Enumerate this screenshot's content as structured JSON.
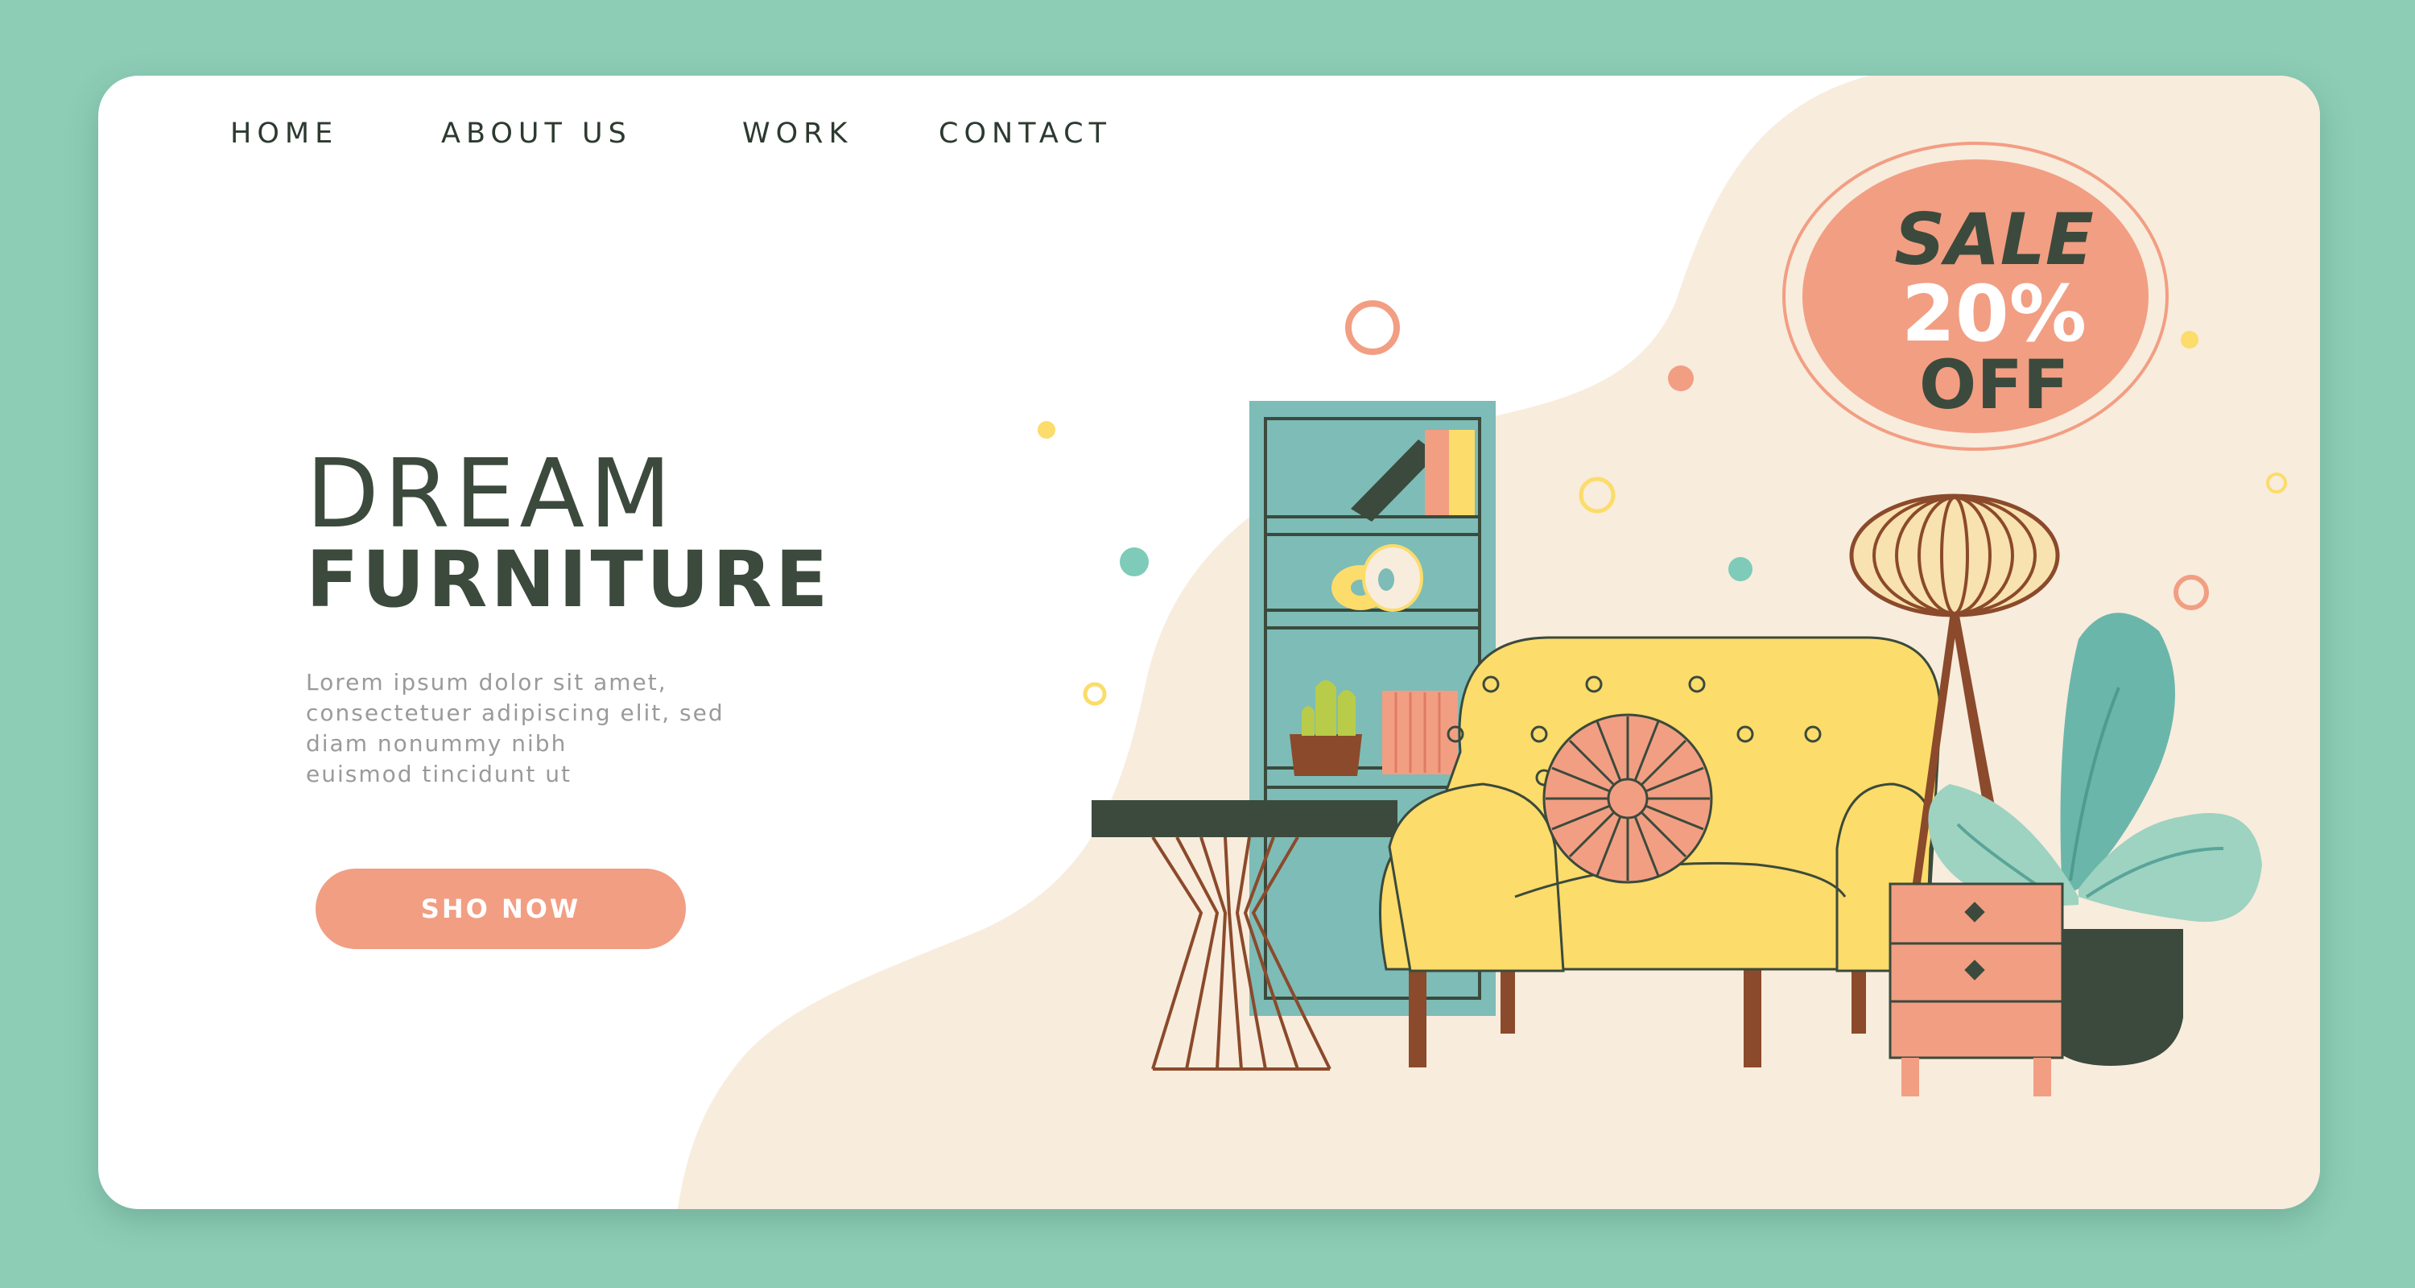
{
  "nav": {
    "items": [
      {
        "label": "HOME"
      },
      {
        "label": "ABOUT US"
      },
      {
        "label": "WORK"
      },
      {
        "label": "CONTACT"
      }
    ]
  },
  "hero": {
    "title_line1": "DREAM",
    "title_line2": "FURNITURE",
    "body_lines": [
      "Lorem ipsum dolor sit amet,",
      "consectetuer adipiscing elit, sed",
      "diam nonummy nibh",
      "euismod tincidunt ut"
    ],
    "cta_label": "SHO NOW"
  },
  "sale_badge": {
    "line1": "SALE",
    "line2": "20%",
    "line3": "OFF"
  },
  "colors": {
    "frame": "#8dcdb6",
    "card": "#ffffff",
    "blob": "#f8ecdd",
    "accent": "#f29e83",
    "dark_text": "#3b4a3c",
    "muted_text": "#9a9a9a",
    "teal": "#7dbcb7",
    "yellow": "#fcdc6a"
  },
  "icons": {
    "illustration": "living-room-furniture-illustration"
  }
}
